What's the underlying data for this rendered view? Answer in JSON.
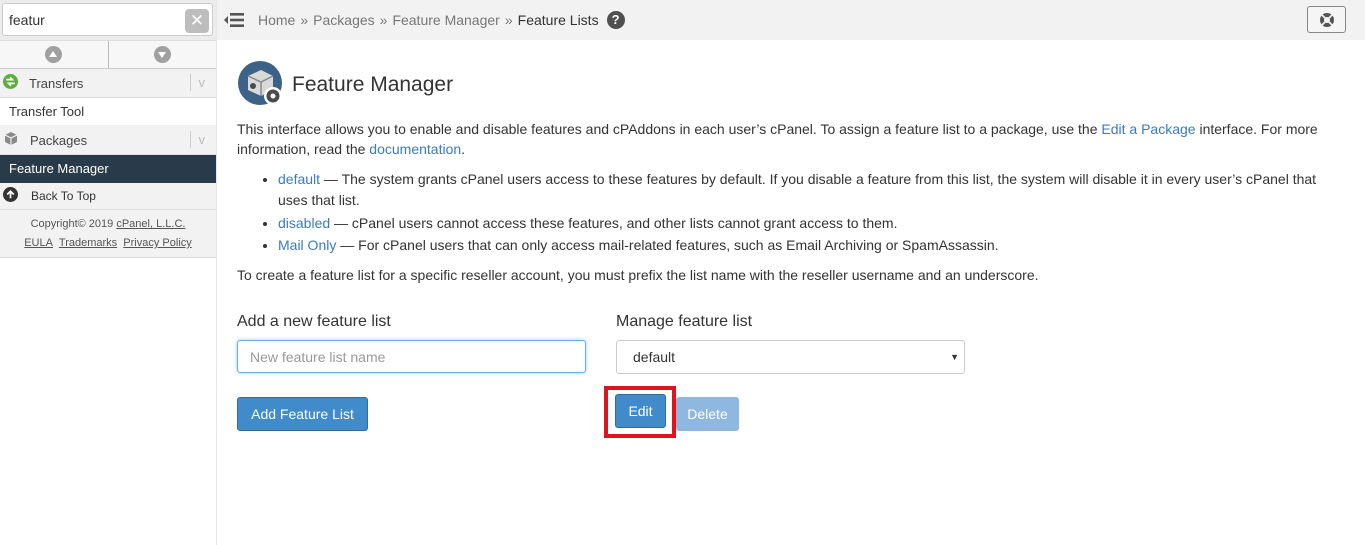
{
  "sidebar": {
    "search": {
      "value": "featur",
      "placeholder": ""
    },
    "clear_label": "✕",
    "categories": [
      {
        "label": "Transfers",
        "icon": "transfers-icon"
      },
      {
        "label": "Packages",
        "icon": "packages-icon"
      }
    ],
    "items": {
      "transfer_tool": "Transfer Tool",
      "feature_manager": "Feature Manager"
    },
    "back_to_top": "Back To Top",
    "copyright": "Copyright© 2019",
    "company": "cPanel, L.L.C.",
    "footer_links": [
      "EULA",
      "Trademarks",
      "Privacy Policy"
    ]
  },
  "breadcrumb": {
    "items": [
      "Home",
      "Packages",
      "Feature Manager"
    ],
    "separator": "»",
    "current": "Feature Lists",
    "help": "?"
  },
  "page": {
    "title": "Feature Manager",
    "intro": {
      "text1": "This interface allows you to enable and disable features and cPAddons in each user’s cPanel. To assign a feature list to a package, use the ",
      "link1": "Edit a Package",
      "text2": " interface. For more information, read the ",
      "link2": "documentation",
      "text3": "."
    },
    "lists": [
      {
        "name": "default",
        "desc": " — The system grants cPanel users access to these features by default. If you disable a feature from this list, the system will disable it in every user’s cPanel that uses that list."
      },
      {
        "name": "disabled",
        "desc": " — cPanel users cannot access these features, and other lists cannot grant access to them."
      },
      {
        "name": "Mail Only",
        "desc": " — For cPanel users that can only access mail-related features, such as Email Archiving or SpamAssassin."
      }
    ],
    "prefix_note": "To create a feature list for a specific reseller account, you must prefix the list name with the reseller username and an underscore."
  },
  "add_form": {
    "label": "Add a new feature list",
    "placeholder": "New feature list name",
    "button": "Add Feature List"
  },
  "manage_form": {
    "label": "Manage feature list",
    "selected": "default",
    "edit_button": "Edit",
    "delete_button": "Delete"
  },
  "colors": {
    "primary": "#428bca",
    "disabled": "#8fb8e1",
    "sidebar_active": "#293a4a",
    "link": "#3a7bbf",
    "highlight": "#e0141e"
  }
}
